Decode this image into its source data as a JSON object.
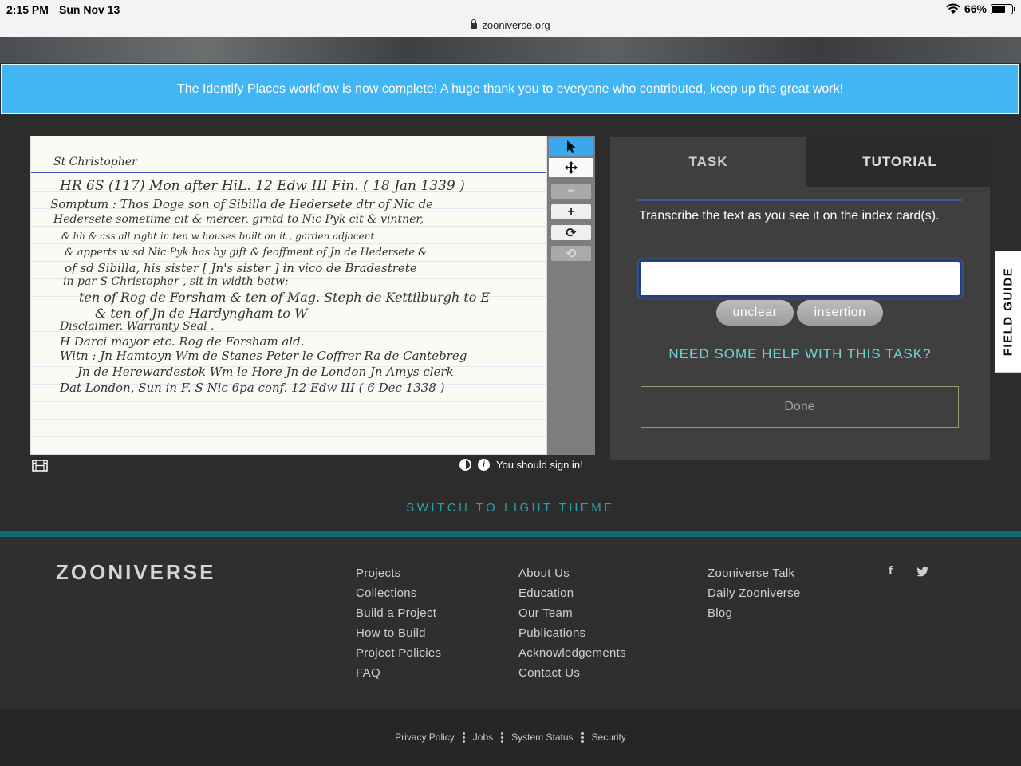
{
  "status_bar": {
    "time": "2:15 PM",
    "date": "Sun Nov 13",
    "url": "zooniverse.org",
    "battery": "66%"
  },
  "announcement": "The Identify Places workflow is now complete! A huge thank you to everyone who contributed, keep up the great work!",
  "subject": {
    "card_lines": [
      "St Christopher",
      "HR 6S   (117)      Mon after HiL.   12 Edw III   Fin. ( 18 Jan 1339 )",
      "Somptum :     Thos Doge son of  Sibilla de Hedersete dtr of Nic de",
      "Hedersete  sometime  cit & mercer,  grntd  to  Nic Pyk  cit & vintner,",
      "& hh & ass   all right   in   ten   w houses   built on it , garden adjacent",
      "& apperts   w sd Nic Pyk   has by gift & feoffment of  Jn de Hedersete &",
      "of sd  Sibilla, his sister [ Jn's sister ]   in   vico de Bradestrete",
      "in par  S Christopher ,   sit   in width   betw:",
      "ten of  Rog de Forsham  & ten of  Mag. Steph de Kettilburgh to  E",
      "& ten  of  Jn de Hardyngham  to  W",
      "Disclaimer.  Warranty   Seal .",
      "H Darci  mayor etc.   Rog de Forsham  ald.",
      "Witn :  Jn Hamtoyn   Wm de Stanes   Peter le Coffrer  Ra de Cantebreg",
      "Jn de Herewardestok   Wm le Hore   Jn de London   Jn Amys clerk",
      "Dat   London, Sun in F.   S   Nic  6pa conf.   12 Edw III   ( 6 Dec  1338 )"
    ]
  },
  "toolbar": {
    "icons": [
      "pointer-icon",
      "move-icon",
      "zoom-out-icon",
      "zoom-in-icon",
      "rotate-icon",
      "reset-icon"
    ],
    "minus": "−",
    "plus": "+",
    "rotate": "⟳",
    "reset": "⟲"
  },
  "under_subject": {
    "sign_in_text": "You should sign in!",
    "info_glyph": "i"
  },
  "task_panel": {
    "tabs": [
      "TASK",
      "TUTORIAL"
    ],
    "instruction": "Transcribe the text as you see it on the index card(s).",
    "input_value": "",
    "input_placeholder": "",
    "buttons": {
      "unclear": "unclear",
      "insertion": "insertion"
    },
    "help": "NEED SOME HELP WITH THIS TASK?",
    "done": "Done"
  },
  "field_guide": "FIELD GUIDE",
  "switch_theme": "SWITCH TO LIGHT THEME",
  "footer": {
    "logo": "ZOONIVERSE",
    "col1": [
      "Projects",
      "Collections",
      "Build a Project",
      "How to Build",
      "Project Policies",
      "FAQ"
    ],
    "col2": [
      "About Us",
      "Education",
      "Our Team",
      "Publications",
      "Acknowledgements",
      "Contact Us"
    ],
    "col3": [
      "Zooniverse Talk",
      "Daily Zooniverse",
      "Blog"
    ],
    "social": {
      "facebook": "f",
      "twitter": "t"
    },
    "bottom_links": [
      "Privacy Policy",
      "Jobs",
      "System Status",
      "Security"
    ]
  },
  "colors": {
    "announcement_bg": "#42b5f4",
    "accent_teal": "#2aa3a8",
    "footer_bar": "#0f6d72",
    "tool_active": "#3aa8ef"
  }
}
